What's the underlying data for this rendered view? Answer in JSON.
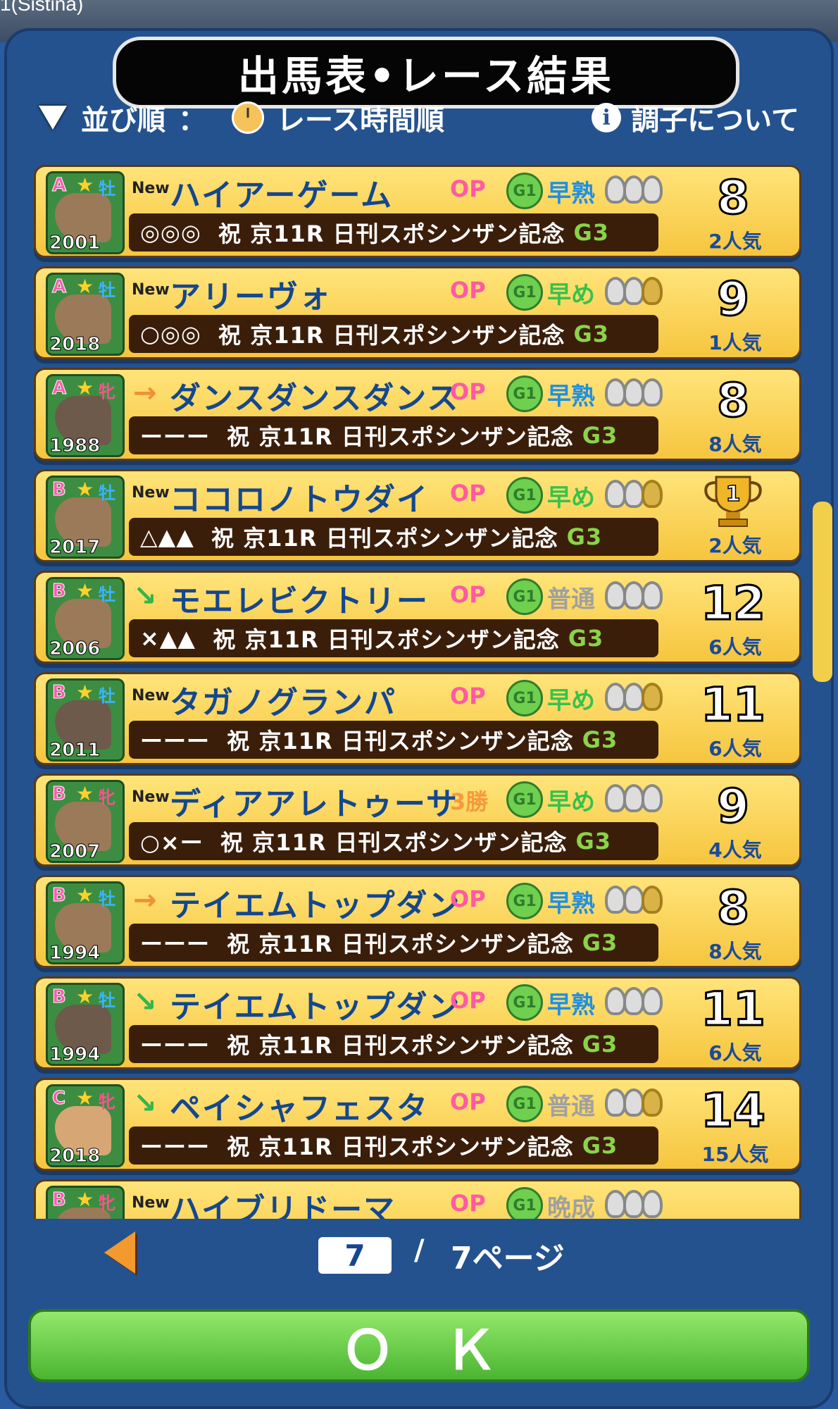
{
  "status_bar": {
    "label": "1(Sistina)"
  },
  "header": {
    "title": "出馬表•レース結果"
  },
  "toolbar": {
    "sort_label": "並び順",
    "sort_sep": "：",
    "sort_value": "レース時間順",
    "condition_label": "調子について"
  },
  "rows": [
    {
      "rank": "A",
      "sex": "牡",
      "year": "2001",
      "badge": "New",
      "trend": "",
      "name": "ハイアーゲーム",
      "class": "OP",
      "growth": "早熟",
      "growth_color": "#1f8fe3",
      "marks": "◎◎◎",
      "race": "祝 京11R 日刊スポシンザン記念",
      "grade": "G3",
      "finish": "8",
      "popularity": "2人気"
    },
    {
      "rank": "A",
      "sex": "牡",
      "year": "2018",
      "badge": "New",
      "trend": "",
      "name": "アリーヴォ",
      "class": "OP",
      "growth": "早め",
      "growth_color": "#36c24a",
      "marks": "○◎◎",
      "race": "祝 京11R 日刊スポシンザン記念",
      "grade": "G3",
      "finish": "9",
      "popularity": "1人気"
    },
    {
      "rank": "A",
      "sex": "牝",
      "year": "1988",
      "badge": "",
      "trend": "→",
      "name": "ダンスダンスダンス",
      "class": "OP",
      "growth": "早熟",
      "growth_color": "#1f8fe3",
      "marks": "ーーー",
      "race": "祝 京11R 日刊スポシンザン記念",
      "grade": "G3",
      "finish": "8",
      "popularity": "8人気"
    },
    {
      "rank": "B",
      "sex": "牡",
      "year": "2017",
      "badge": "New",
      "trend": "",
      "name": "ココロノトウダイ",
      "class": "OP",
      "growth": "早め",
      "growth_color": "#36c24a",
      "marks": "△▲▲",
      "race": "祝 京11R 日刊スポシンザン記念",
      "grade": "G3",
      "finish": "1",
      "popularity": "2人気"
    },
    {
      "rank": "B",
      "sex": "牡",
      "year": "2006",
      "badge": "",
      "trend": "↘",
      "name": "モエレビクトリー",
      "class": "OP",
      "growth": "普通",
      "growth_color": "#a0a0a0",
      "marks": "×▲▲",
      "race": "祝 京11R 日刊スポシンザン記念",
      "grade": "G3",
      "finish": "12",
      "popularity": "6人気"
    },
    {
      "rank": "B",
      "sex": "牡",
      "year": "2011",
      "badge": "New",
      "trend": "",
      "name": "タガノグランパ",
      "class": "OP",
      "growth": "早め",
      "growth_color": "#36c24a",
      "marks": "ーーー",
      "race": "祝 京11R 日刊スポシンザン記念",
      "grade": "G3",
      "finish": "11",
      "popularity": "6人気"
    },
    {
      "rank": "B",
      "sex": "牝",
      "year": "2007",
      "badge": "New",
      "trend": "",
      "name": "ディアアレトゥーサ",
      "class": "3勝",
      "growth": "早め",
      "growth_color": "#36c24a",
      "marks": "○×ー",
      "race": "祝 京11R 日刊スポシンザン記念",
      "grade": "G3",
      "finish": "9",
      "popularity": "4人気"
    },
    {
      "rank": "B",
      "sex": "牡",
      "year": "1994",
      "badge": "",
      "trend": "→",
      "name": "テイエムトップダン",
      "class": "OP",
      "growth": "早熟",
      "growth_color": "#1f8fe3",
      "marks": "ーーー",
      "race": "祝 京11R 日刊スポシンザン記念",
      "grade": "G3",
      "finish": "8",
      "popularity": "8人気"
    },
    {
      "rank": "B",
      "sex": "牡",
      "year": "1994",
      "badge": "",
      "trend": "↘",
      "name": "テイエムトップダン",
      "class": "OP",
      "growth": "早熟",
      "growth_color": "#1f8fe3",
      "marks": "ーーー",
      "race": "祝 京11R 日刊スポシンザン記念",
      "grade": "G3",
      "finish": "11",
      "popularity": "6人気"
    },
    {
      "rank": "C",
      "sex": "牝",
      "year": "2018",
      "badge": "",
      "trend": "↘",
      "name": "ペイシャフェスタ",
      "class": "OP",
      "growth": "普通",
      "growth_color": "#a0a0a0",
      "marks": "ーーー",
      "race": "祝 京11R 日刊スポシンザン記念",
      "grade": "G3",
      "finish": "14",
      "popularity": "15人気"
    },
    {
      "rank": "B",
      "sex": "牝",
      "year": "",
      "badge": "New",
      "trend": "",
      "name": "ハイブリドーマ",
      "class": "OP",
      "growth": "晩成",
      "growth_color": "#a0a0a0",
      "marks": "",
      "race": "",
      "grade": "",
      "finish": "",
      "popularity": ""
    }
  ],
  "pager": {
    "current": "7",
    "separator": "/",
    "total": "7ページ"
  },
  "ok_label": "ＯＫ"
}
